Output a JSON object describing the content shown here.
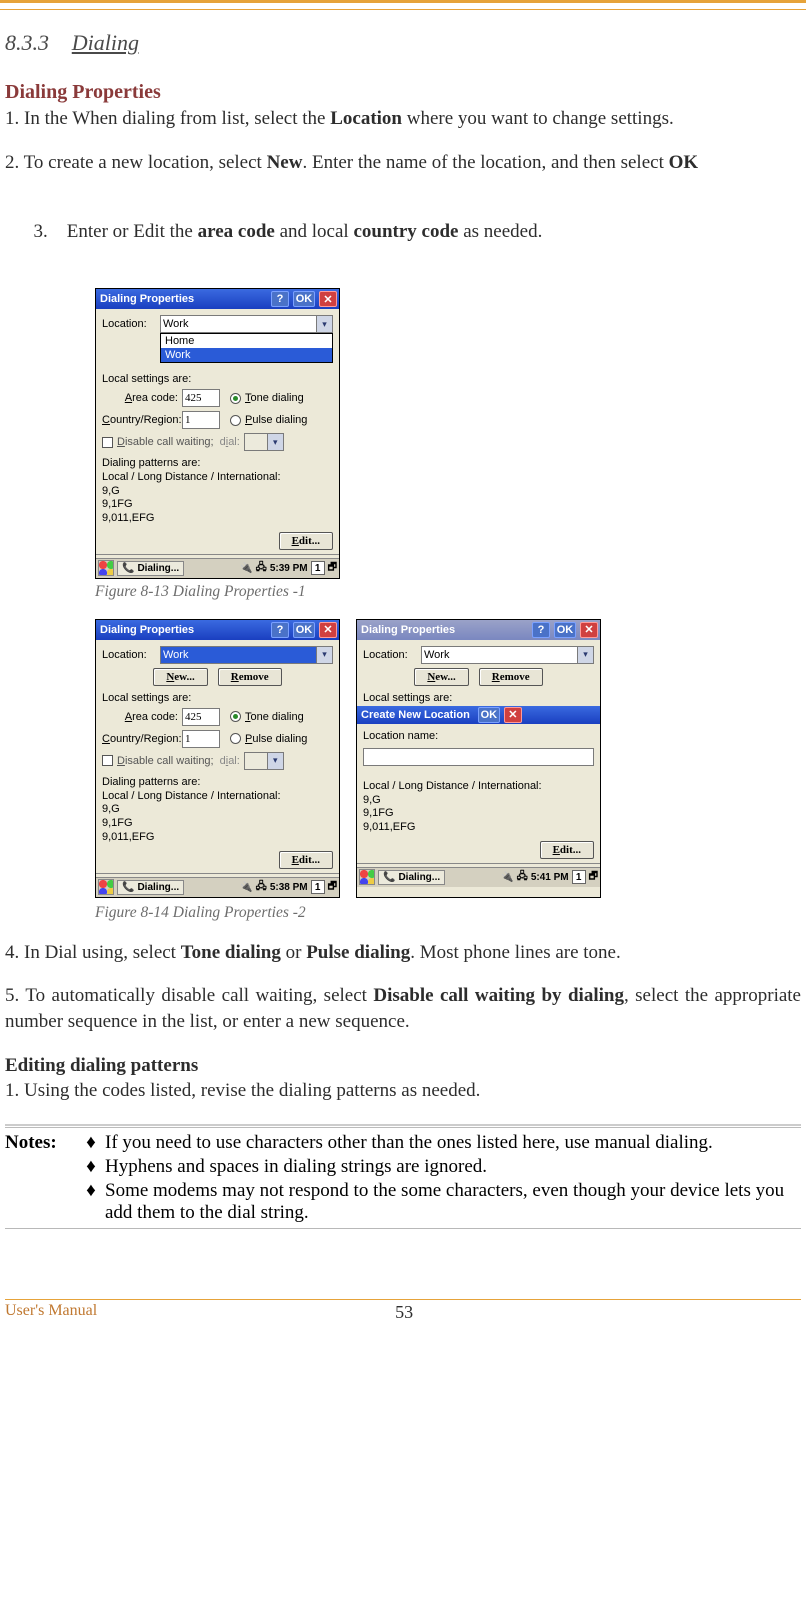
{
  "section": {
    "number": "8.3.3",
    "title": "Dialing"
  },
  "h_dialing_props": "Dialing Properties",
  "step1_a": "1. In the When dialing from list, select the ",
  "step1_b": "Location",
  "step1_c": " where you want to change settings.",
  "step2_a": "2. To create a new location, select ",
  "step2_b": "New",
  "step2_c": ". Enter the name of the location, and then select ",
  "step2_d": "OK",
  "step3_a": "3.    Enter or Edit the ",
  "step3_b": "area code",
  "step3_c": " and local ",
  "step3_d": "country code",
  "step3_e": " as needed.",
  "fig1_caption": "Figure 8-13 Dialing Properties -1",
  "fig2_caption": "Figure 8-14 Dialing Properties -2",
  "step4_a": "4. In Dial using, select ",
  "step4_b": "Tone dialing",
  "step4_c": " or ",
  "step4_d": "Pulse dialing",
  "step4_e": ". Most phone lines are tone.",
  "step5_a": "5.  To  automatically  disable  call  waiting,  select  ",
  "step5_b": "Disable  call  waiting  by  dialing",
  "step5_c": ",  select  the appropriate number sequence in the list, or enter a new sequence.",
  "h_editing": "Editing dialing patterns",
  "edit_step1": "1. Using the codes listed, revise the dialing patterns as needed.",
  "notes_label": "Notes:",
  "notes": {
    "n1": "If you need to use characters other than the ones listed here, use manual dialing.",
    "n2": "Hyphens and spaces in dialing strings are ignored.",
    "n3": "Some modems may not respond to the some characters, even though your device lets you add them to the dial string."
  },
  "diamond": "♦",
  "footer": {
    "left": "User's Manual",
    "page": "53"
  },
  "win_title": "Dialing Properties",
  "lbl_location": "Location:",
  "lbl_local_settings": "Local settings are:",
  "lbl_area": "Area code:",
  "lbl_country": "Country/Region:",
  "lbl_disable_cw": "Disable call waiting;",
  "lbl_dial": "dial:",
  "lbl_patterns_hdr": "Dialing patterns are:",
  "lbl_patterns_sub": "Local / Long Distance / International:",
  "pattern_lines": {
    "l1": "9,G",
    "l2": "9,1FG",
    "l3": "9,011,EFG"
  },
  "val_area": "425",
  "val_country": "1",
  "opt_tone": "Tone dialing",
  "opt_pulse": "Pulse dialing",
  "btn_ok": "OK",
  "btn_help": "?",
  "btn_close": "✕",
  "btn_edit": "Edit...",
  "btn_new": "New...",
  "btn_remove": "Remove",
  "task_dialing": "Dialing...",
  "ind_1": "1",
  "loc_work": "Work",
  "loc_home": "Home",
  "time_1": "5:39 PM",
  "time_2": "5:38 PM",
  "time_3": "5:41 PM",
  "popup_title": "Create New Location",
  "popup_lbl": "Location name:"
}
